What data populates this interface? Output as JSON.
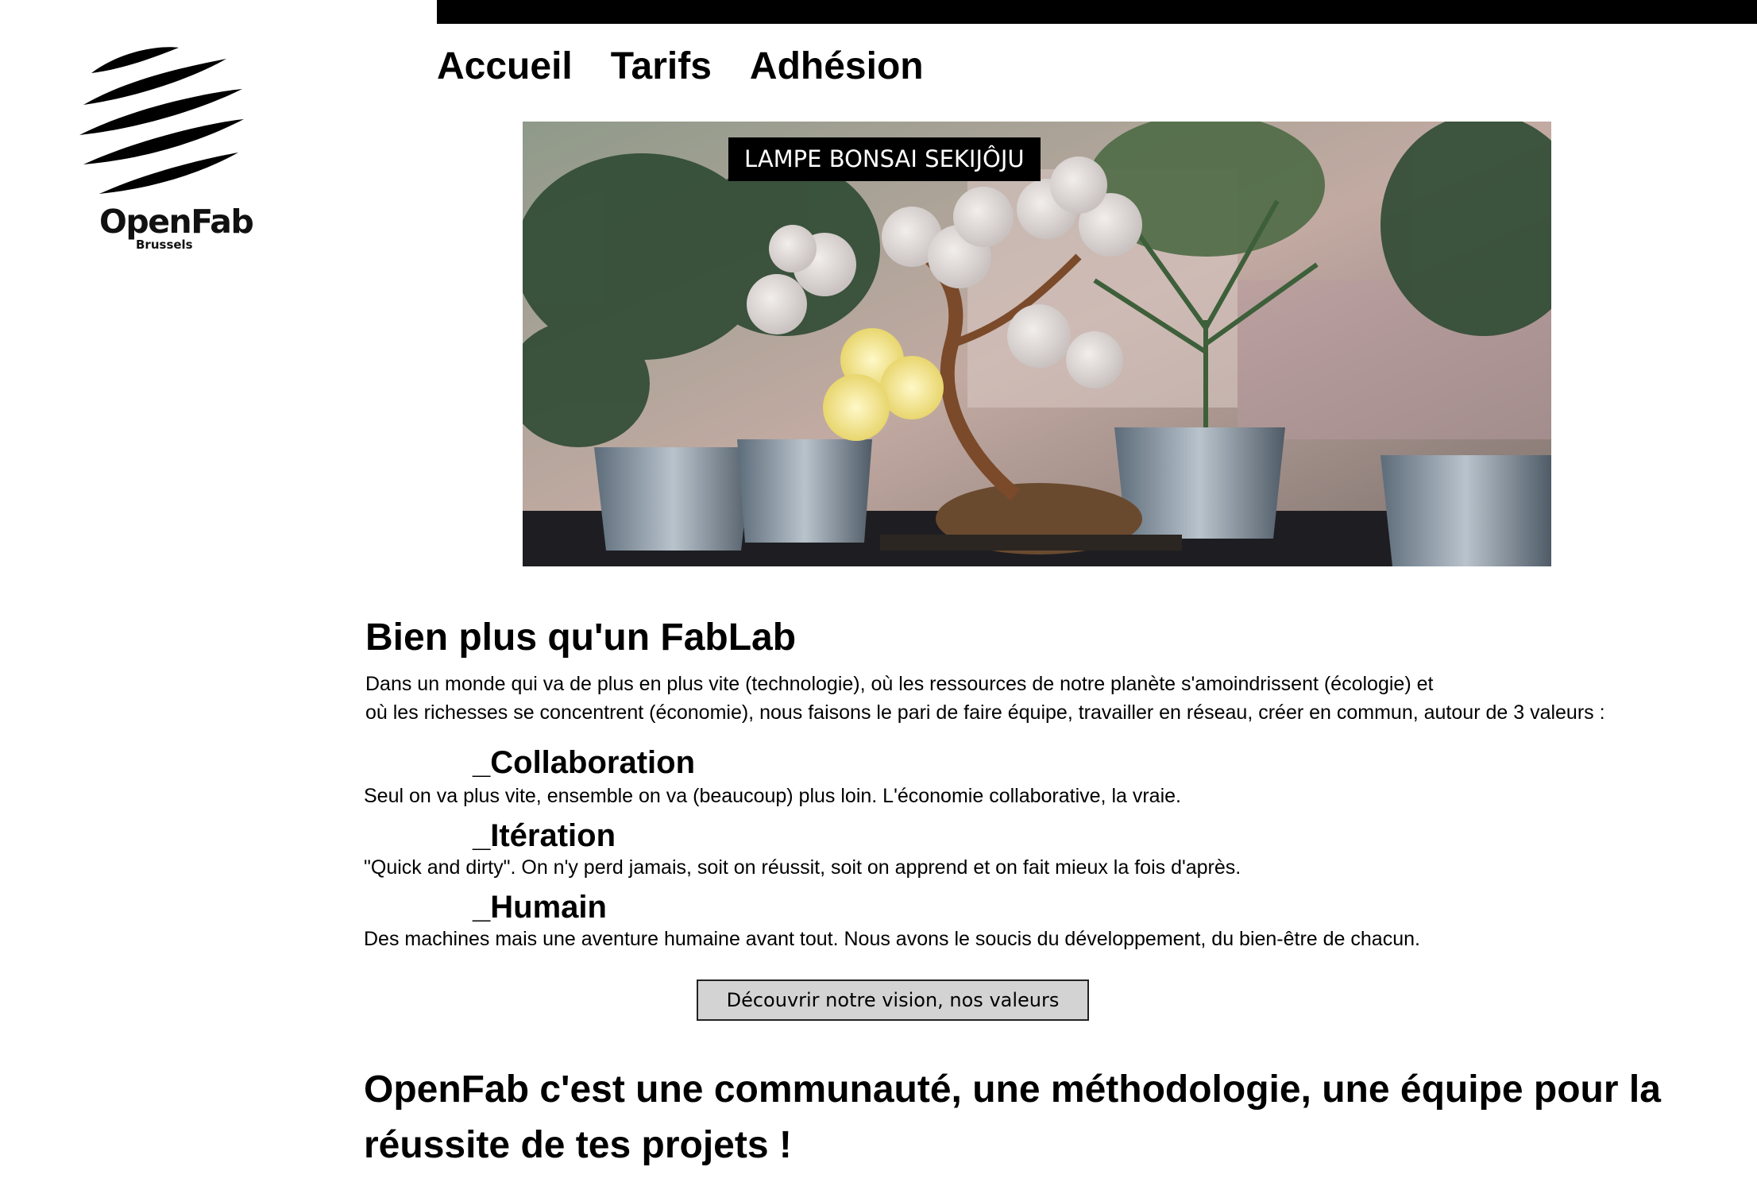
{
  "brand": {
    "name": "OpenFab",
    "city": "Brussels"
  },
  "nav": {
    "items": [
      "Accueil",
      "Tarifs",
      "Adhésion"
    ]
  },
  "hero": {
    "caption": "LAMPE BONSAI SEKIJÔJU"
  },
  "about": {
    "title": "Bien plus qu'un FabLab",
    "intro_line1": "Dans un monde qui va de plus en plus vite (technologie), où les ressources de notre planète s'amoindrissent (écologie) et",
    "intro_line2": "où les richesses se concentrent (économie), nous faisons le pari de faire équipe, travailler en réseau, créer en commun, autour de 3 valeurs :",
    "values": [
      {
        "title": "_Collaboration",
        "desc": "Seul on va plus vite, ensemble on va (beaucoup) plus loin. L'économie collaborative, la vraie."
      },
      {
        "title": "_Itération",
        "desc": "\"Quick and dirty\". On n'y perd jamais, soit on réussit, soit on apprend et on fait mieux la fois d'après."
      },
      {
        "title": "_Humain",
        "desc": "Des machines mais une aventure humaine avant tout. Nous avons le soucis du développement, du bien-être de chacun."
      }
    ],
    "cta_label": "Découvrir notre vision, nos valeurs"
  },
  "tagline": "OpenFab c'est une communauté, une méthodologie, une équipe pour la réussite de tes projets !"
}
